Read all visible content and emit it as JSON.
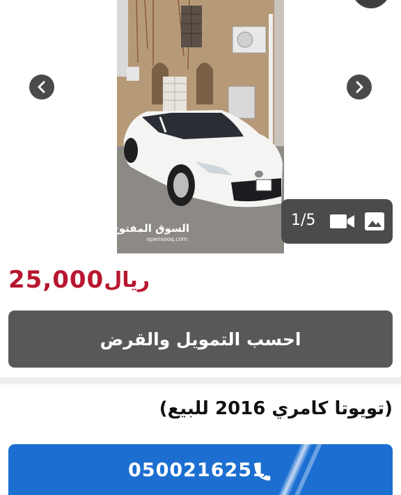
{
  "gallery": {
    "counter": "1/5",
    "watermark_ar": "السوق المفتوح",
    "watermark_en": "opensooq.com",
    "prev_icon": "chevron-left-icon",
    "next_icon": "chevron-right-icon",
    "video_icon": "video-camera-icon",
    "image_icon": "image-icon"
  },
  "listing": {
    "price_value": "25,000",
    "price_currency": "ريال",
    "finance_button_label": "احسب التمويل والقرض",
    "title": "(تويوتا كامري 2016 للبيع)",
    "phone_number": "0500216251",
    "phone_icon": "phone-icon"
  },
  "colors": {
    "price": "#b8162f",
    "finance_button": "#585858",
    "call_button": "#1c6fd1"
  }
}
